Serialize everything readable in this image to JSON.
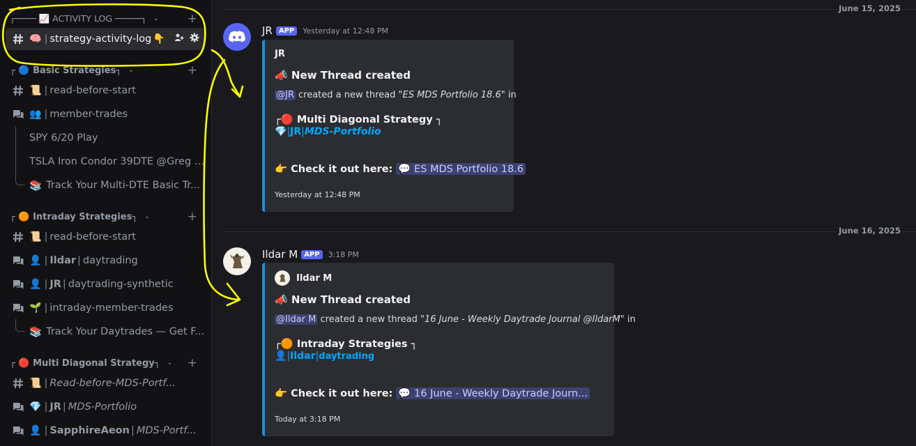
{
  "sidebar": {
    "activity_category": "┌──── 📈 ACTIVITY LOG ─────┐",
    "activity_channel": {
      "emoji": "🧠",
      "name": "strategy-activity-log",
      "suffix": "👇"
    },
    "basic_category": {
      "prefix": "┌",
      "emoji": "🔵",
      "name": "Basic Strategies",
      "suffix": "┐"
    },
    "basic_read": {
      "emoji": "📜",
      "name": "read-before-start"
    },
    "basic_member_trades": {
      "emoji": "👥",
      "name": "member-trades"
    },
    "threads_basic": [
      {
        "name": "SPY 6/20 Play"
      },
      {
        "name": "TSLA Iron Condor 39DTE @Greg |..."
      },
      {
        "emoji": "📚",
        "name": "Track Your Multi-DTE Basic Tr..."
      }
    ],
    "intraday_category": {
      "prefix": "┌",
      "emoji": "🟠",
      "name": "Intraday Strategies",
      "suffix": "┐"
    },
    "intraday_read": {
      "emoji": "📜",
      "name": "read-before-start"
    },
    "intraday_ildar": {
      "emoji": "👤",
      "bold": "Ildar",
      "name": "daytrading"
    },
    "intraday_jr": {
      "emoji": "👤",
      "bold": "JR",
      "name": "daytrading-synthetic"
    },
    "intraday_members": {
      "emoji": "🌱",
      "name": "intraday-member-trades"
    },
    "threads_intraday": [
      {
        "emoji": "📚",
        "name": "Track Your Daytrades — Get F..."
      }
    ],
    "mds_category": {
      "prefix": "┌",
      "emoji": "🔴",
      "name": "Multi Diagonal Strategy",
      "suffix": "┐"
    },
    "mds_read": {
      "emoji": "📜",
      "name": "Read-before-MDS-Portf..."
    },
    "mds_jr": {
      "emoji": "💎",
      "bold": "JR",
      "name": "MDS-Portfolio"
    },
    "mds_sapphire": {
      "emoji": "👤",
      "bold": "SapphireAeon",
      "name": "MDS-Portf..."
    }
  },
  "messages": [
    {
      "date_divider": "June 15, 2025",
      "author": "JR",
      "app_tag": "APP",
      "timestamp": "Yesterday at 12:48 PM",
      "embed": {
        "author": "JR",
        "title": "📣 New Thread created",
        "mention": "@JR",
        "desc_middle": " created a new thread ",
        "thread_quote": "\"ES MDS Portfolio 18.6\"",
        "desc_end": " in",
        "category_line": "┌🔴 Multi Diagonal Strategy ┐",
        "sub_emoji": "💎",
        "sub_bold": "JR",
        "sub_name": "MDS-Portfolio",
        "cta": "👉 Check it out here:",
        "thread_link": "💬 ES MDS Portfolio 18.6",
        "footer": "Yesterday at 12:48 PM"
      }
    },
    {
      "date_divider": "June 16, 2025",
      "author": "Ildar M",
      "app_tag": "APP",
      "timestamp": "3:18 PM",
      "embed": {
        "author": "Ildar M",
        "title": "📣 New Thread created",
        "mention": "@Ildar M",
        "desc_middle": " created a new thread ",
        "thread_quote": "\"16 June - Weekly Daytrade Journal @IldarM\"",
        "desc_end": " in",
        "category_line": "┌🟠 Intraday Strategies ┐",
        "sub_emoji": "👤",
        "sub_bold": "Ildar",
        "sub_name": "daytrading",
        "cta": "👉 Check it out here:",
        "thread_link": "💬 16 June - Weekly Daytrade Journ...",
        "footer": "Today at 3:18 PM"
      }
    }
  ],
  "colors": {
    "embed_border": "#1a8fdd",
    "app_tag": "#5865f2",
    "annotation": "#ffff00",
    "discord_blurple": "#5865f2"
  }
}
